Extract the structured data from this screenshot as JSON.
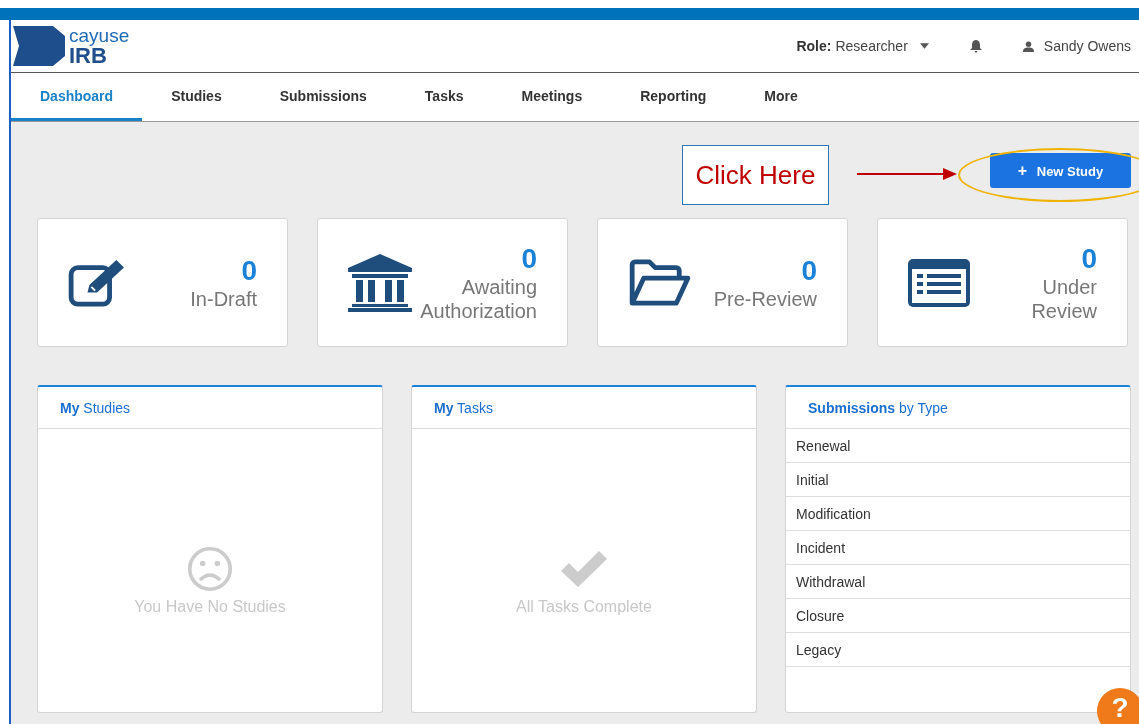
{
  "header": {
    "logo_top": "cayuse",
    "logo_bottom": "IRB",
    "role_label": "Role:",
    "role_value": "Researcher",
    "user": "Sandy Owens"
  },
  "nav": [
    {
      "label": "Dashboard",
      "selected": true
    },
    {
      "label": "Studies",
      "selected": false
    },
    {
      "label": "Submissions",
      "selected": false
    },
    {
      "label": "Tasks",
      "selected": false
    },
    {
      "label": "Meetings",
      "selected": false
    },
    {
      "label": "Reporting",
      "selected": false
    },
    {
      "label": "More",
      "selected": false
    }
  ],
  "callout": {
    "text": "Click Here"
  },
  "new_study_button": {
    "icon": "+",
    "label": "New Study"
  },
  "stats": [
    {
      "kind": "draft",
      "count": "0",
      "label": "In-Draft"
    },
    {
      "kind": "authorization",
      "count": "0",
      "label": "Awaiting Authorization"
    },
    {
      "kind": "prereview",
      "count": "0",
      "label": "Pre-Review"
    },
    {
      "kind": "review",
      "count": "0",
      "label": "Under Review"
    }
  ],
  "panels": [
    {
      "kind": "studies",
      "title": "**My** Studies",
      "message": "You Have No Studies"
    },
    {
      "kind": "tasks",
      "title": "**My** Tasks",
      "message": "All Tasks Complete"
    },
    {
      "kind": "list",
      "title": "**Submissions** by Type",
      "items": [
        "Renewal",
        "Initial",
        "Modification",
        "Incident",
        "Withdrawal",
        "Closure",
        "Legacy"
      ]
    }
  ],
  "help": {
    "label": "?"
  }
}
